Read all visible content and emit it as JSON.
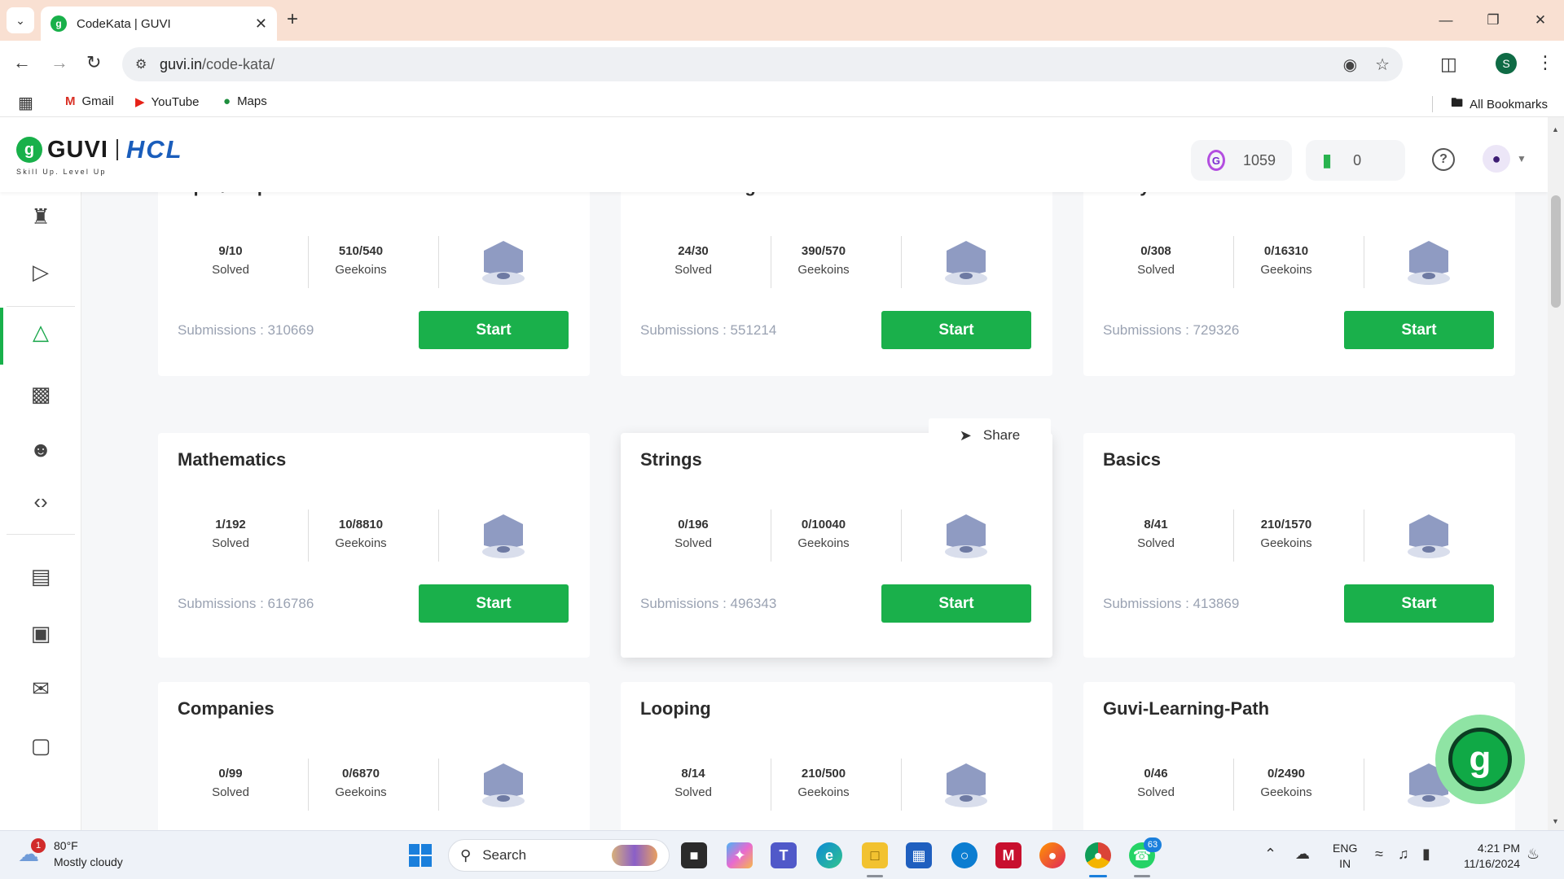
{
  "browser": {
    "tab_title": "CodeKata | GUVI",
    "url_host": "guvi.in",
    "url_path": "/code-kata/",
    "bookmarks": [
      "Gmail",
      "YouTube",
      "Maps"
    ],
    "all_bookmarks": "All Bookmarks",
    "profile_initial": "S"
  },
  "header": {
    "logo_text": "GUVI",
    "logo_partner": "HCL",
    "tagline": "Skill Up. Level Up",
    "geekoins": "1059",
    "trophies": "0"
  },
  "share_label": "Share",
  "cards": [
    {
      "title": "Input/Output",
      "solved": "9/10",
      "solved_label": "Solved",
      "geekoins": "510/540",
      "geekoins_label": "Geekoins",
      "submissions": "Submissions : 310669",
      "button": "Start"
    },
    {
      "title": "Absolute Beginner",
      "solved": "24/30",
      "solved_label": "Solved",
      "geekoins": "390/570",
      "geekoins_label": "Geekoins",
      "submissions": "Submissions : 551214",
      "button": "Start"
    },
    {
      "title": "Array",
      "solved": "0/308",
      "solved_label": "Solved",
      "geekoins": "0/16310",
      "geekoins_label": "Geekoins",
      "submissions": "Submissions : 729326",
      "button": "Start"
    },
    {
      "title": "Mathematics",
      "solved": "1/192",
      "solved_label": "Solved",
      "geekoins": "10/8810",
      "geekoins_label": "Geekoins",
      "submissions": "Submissions : 616786",
      "button": "Start"
    },
    {
      "title": "Strings",
      "solved": "0/196",
      "solved_label": "Solved",
      "geekoins": "0/10040",
      "geekoins_label": "Geekoins",
      "submissions": "Submissions : 496343",
      "button": "Start"
    },
    {
      "title": "Basics",
      "solved": "8/41",
      "solved_label": "Solved",
      "geekoins": "210/1570",
      "geekoins_label": "Geekoins",
      "submissions": "Submissions : 413869",
      "button": "Start"
    },
    {
      "title": "Companies",
      "solved": "0/99",
      "solved_label": "Solved",
      "geekoins": "0/6870",
      "geekoins_label": "Geekoins",
      "submissions": "",
      "button": ""
    },
    {
      "title": "Looping",
      "solved": "8/14",
      "solved_label": "Solved",
      "geekoins": "210/500",
      "geekoins_label": "Geekoins",
      "submissions": "",
      "button": ""
    },
    {
      "title": "Guvi-Learning-Path",
      "solved": "0/46",
      "solved_label": "Solved",
      "geekoins": "0/2490",
      "geekoins_label": "Geekoins",
      "submissions": "",
      "button": ""
    }
  ],
  "taskbar": {
    "temp": "80°F",
    "weather": "Mostly cloudy",
    "weather_badge": "1",
    "search_placeholder": "Search",
    "whatsapp_badge": "63",
    "lang_line1": "ENG",
    "lang_line2": "IN",
    "time": "4:21 PM",
    "date": "11/16/2024"
  },
  "colors": {
    "accent": "#1ab04b",
    "hcl_blue": "#1a5dbb"
  }
}
